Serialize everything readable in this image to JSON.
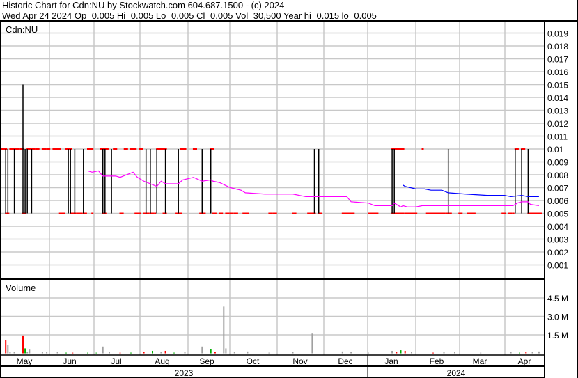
{
  "header": {
    "title": "Historic Chart for Cdn:NU by Stockwatch.com 604.687.1500 - (c) 2024",
    "summary": "Wed Apr 24 2024  Op=0.005  Hi=0.005  Lo=0.005  Cl=0.005  Vol=30,500  Year hi=0.015  lo=0.005"
  },
  "chart_data": [
    {
      "type": "line",
      "title": "Cdn:NU",
      "x_unit": "trading day index (0 = late Apr 2023)",
      "ylim": [
        0,
        0.02
      ],
      "y_ticks": [
        "0.001",
        "0.002",
        "0.003",
        "0.004",
        "0.005",
        "0.006",
        "0.007",
        "0.008",
        "0.009",
        "0.01",
        "0.011",
        "0.012",
        "0.013",
        "0.014",
        "0.015",
        "0.016",
        "0.017",
        "0.018",
        "0.019"
      ],
      "grid": true,
      "colors": {
        "close": "#ff0000",
        "range": "#000000",
        "ma_short": "#ff00ff",
        "ma_long": "#0000ff"
      },
      "close_segments_0_01": [
        [
          0,
          2
        ],
        [
          4,
          8
        ],
        [
          9,
          10
        ],
        [
          12,
          15
        ],
        [
          16,
          17
        ],
        [
          19,
          20
        ],
        [
          21,
          22
        ],
        [
          24,
          27
        ],
        [
          30,
          32
        ],
        [
          40,
          42
        ],
        [
          46,
          47
        ],
        [
          48,
          49
        ],
        [
          52,
          53
        ],
        [
          57,
          58
        ],
        [
          60,
          62
        ],
        [
          64,
          65
        ],
        [
          72,
          76
        ],
        [
          83,
          85
        ],
        [
          89,
          90
        ],
        [
          97,
          98
        ],
        [
          181,
          186
        ],
        [
          195,
          195
        ],
        [
          238,
          239
        ],
        [
          241,
          242
        ]
      ],
      "close_segments_0_005": [
        [
          2,
          3
        ],
        [
          10,
          11
        ],
        [
          27,
          29
        ],
        [
          32,
          34
        ],
        [
          35,
          37
        ],
        [
          38,
          39
        ],
        [
          42,
          42
        ],
        [
          47,
          48
        ],
        [
          55,
          56
        ],
        [
          62,
          64
        ],
        [
          66,
          68
        ],
        [
          69,
          70
        ],
        [
          71,
          71
        ],
        [
          75,
          76
        ],
        [
          81,
          83
        ],
        [
          92,
          94
        ],
        [
          98,
          99
        ],
        [
          101,
          102
        ],
        [
          104,
          105
        ],
        [
          106,
          107
        ],
        [
          108,
          109
        ],
        [
          112,
          114
        ],
        [
          124,
          125
        ],
        [
          126,
          127
        ],
        [
          135,
          136
        ],
        [
          142,
          144
        ],
        [
          144,
          145
        ],
        [
          147,
          148
        ],
        [
          158,
          163
        ],
        [
          170,
          174
        ],
        [
          181,
          182
        ],
        [
          183,
          184
        ],
        [
          185,
          186
        ],
        [
          187,
          192
        ],
        [
          197,
          198
        ],
        [
          199,
          201
        ],
        [
          202,
          204
        ],
        [
          204,
          205
        ],
        [
          206,
          208
        ],
        [
          212,
          213
        ],
        [
          216,
          217
        ],
        [
          218,
          219
        ],
        [
          232,
          233
        ],
        [
          235,
          236
        ],
        [
          237,
          237
        ],
        [
          244,
          250
        ]
      ],
      "range_bars": [
        [
          2,
          0.005,
          0.01
        ],
        [
          3,
          0.005,
          0.01
        ],
        [
          6,
          0.005,
          0.01
        ],
        [
          10,
          0.005,
          0.015
        ],
        [
          11,
          0.005,
          0.01
        ],
        [
          12,
          0.005,
          0.01
        ],
        [
          14,
          0.005,
          0.01
        ],
        [
          31,
          0.005,
          0.01
        ],
        [
          32,
          0.005,
          0.01
        ],
        [
          34,
          0.005,
          0.01
        ],
        [
          38,
          0.005,
          0.01
        ],
        [
          47,
          0.005,
          0.01
        ],
        [
          48,
          0.005,
          0.01
        ],
        [
          51,
          0.005,
          0.01
        ],
        [
          67,
          0.005,
          0.01
        ],
        [
          69,
          0.005,
          0.01
        ],
        [
          72,
          0.005,
          0.01
        ],
        [
          76,
          0.005,
          0.01
        ],
        [
          82,
          0.005,
          0.01
        ],
        [
          93,
          0.005,
          0.01
        ],
        [
          97,
          0.005,
          0.01
        ],
        [
          145,
          0.005,
          0.01
        ],
        [
          147,
          0.005,
          0.01
        ],
        [
          181,
          0.005,
          0.01
        ],
        [
          182,
          0.005,
          0.01
        ],
        [
          207,
          0.005,
          0.01
        ],
        [
          238,
          0.005,
          0.01
        ],
        [
          241,
          0.005,
          0.01
        ],
        [
          244,
          0.005,
          0.01
        ]
      ],
      "ma_short": [
        [
          40,
          0.0083
        ],
        [
          42,
          0.0082
        ],
        [
          45,
          0.0083
        ],
        [
          47,
          0.0079
        ],
        [
          53,
          0.0079
        ],
        [
          55,
          0.0078
        ],
        [
          61,
          0.0082
        ],
        [
          63,
          0.0078
        ],
        [
          66,
          0.0075
        ],
        [
          72,
          0.0071
        ],
        [
          74,
          0.0075
        ],
        [
          76,
          0.0073
        ],
        [
          82,
          0.0073
        ],
        [
          84,
          0.0076
        ],
        [
          89,
          0.0078
        ],
        [
          93,
          0.0075
        ],
        [
          97,
          0.0076
        ],
        [
          98,
          0.0075
        ],
        [
          101,
          0.0074
        ],
        [
          106,
          0.007
        ],
        [
          111,
          0.0068
        ],
        [
          113,
          0.0066
        ],
        [
          122,
          0.0065
        ],
        [
          135,
          0.0065
        ],
        [
          141,
          0.0063
        ],
        [
          160,
          0.0063
        ],
        [
          162,
          0.0059
        ],
        [
          170,
          0.0058
        ],
        [
          173,
          0.0056
        ],
        [
          181,
          0.0056
        ],
        [
          182,
          0.0058
        ],
        [
          185,
          0.0055
        ],
        [
          186,
          0.0056
        ],
        [
          188,
          0.0055
        ],
        [
          192,
          0.0055
        ],
        [
          195,
          0.0056
        ],
        [
          237,
          0.0056
        ],
        [
          239,
          0.0058
        ],
        [
          241,
          0.0059
        ],
        [
          244,
          0.0059
        ],
        [
          245,
          0.0057
        ],
        [
          249,
          0.0056
        ]
      ],
      "ma_long": [
        [
          186,
          0.0072
        ],
        [
          187,
          0.0071
        ],
        [
          192,
          0.0069
        ],
        [
          196,
          0.0069
        ],
        [
          199,
          0.0068
        ],
        [
          204,
          0.0068
        ],
        [
          207,
          0.0066
        ],
        [
          215,
          0.0065
        ],
        [
          225,
          0.0064
        ],
        [
          233,
          0.0064
        ],
        [
          236,
          0.0063
        ],
        [
          241,
          0.0064
        ],
        [
          244,
          0.0063
        ],
        [
          249,
          0.0063
        ]
      ]
    },
    {
      "type": "bar",
      "title": "Volume",
      "ylim": [
        0,
        6.0
      ],
      "y_unit": "M",
      "y_ticks": [
        "1.5 M",
        "3.0 M",
        "4.5 M"
      ],
      "colors": {
        "up": "#00b000",
        "down": "#ff0000",
        "flat": "#a0a0a0"
      },
      "bars": [
        [
          2,
          1.1,
          "down"
        ],
        [
          3,
          0.7,
          "flat"
        ],
        [
          4,
          0.1,
          "flat"
        ],
        [
          6,
          0.1,
          "flat"
        ],
        [
          10,
          1.45,
          "down"
        ],
        [
          11,
          0.4,
          "up"
        ],
        [
          12,
          0.1,
          "flat"
        ],
        [
          13,
          0.3,
          "flat"
        ],
        [
          19,
          0.1,
          "flat"
        ],
        [
          21,
          0.1,
          "flat"
        ],
        [
          26,
          0.1,
          "flat"
        ],
        [
          30,
          0.05,
          "up"
        ],
        [
          33,
          0.05,
          "down"
        ],
        [
          40,
          0.05,
          "up"
        ],
        [
          44,
          0.05,
          "up"
        ],
        [
          47,
          0.55,
          "flat"
        ],
        [
          50,
          0.1,
          "flat"
        ],
        [
          55,
          0.05,
          "down"
        ],
        [
          60,
          0.05,
          "up"
        ],
        [
          66,
          0.1,
          "down"
        ],
        [
          70,
          0.2,
          "up"
        ],
        [
          74,
          0.1,
          "flat"
        ],
        [
          76,
          0.2,
          "down"
        ],
        [
          80,
          0.05,
          "up"
        ],
        [
          85,
          0.1,
          "flat"
        ],
        [
          93,
          0.55,
          "flat"
        ],
        [
          97,
          0.35,
          "up"
        ],
        [
          99,
          0.1,
          "down"
        ],
        [
          103,
          3.8,
          "flat"
        ],
        [
          104,
          0.4,
          "flat"
        ],
        [
          108,
          0.1,
          "flat"
        ],
        [
          114,
          0.15,
          "flat"
        ],
        [
          124,
          0.05,
          "flat"
        ],
        [
          135,
          0.1,
          "flat"
        ],
        [
          144,
          1.6,
          "flat"
        ],
        [
          158,
          0.15,
          "flat"
        ],
        [
          162,
          0.1,
          "flat"
        ],
        [
          170,
          0.05,
          "flat"
        ],
        [
          181,
          0.2,
          "flat"
        ],
        [
          183,
          0.1,
          "down"
        ],
        [
          185,
          0.25,
          "up"
        ],
        [
          187,
          0.2,
          "down"
        ],
        [
          190,
          0.1,
          "flat"
        ],
        [
          200,
          0.05,
          "down"
        ],
        [
          205,
          0.1,
          "flat"
        ],
        [
          210,
          0.1,
          "flat"
        ],
        [
          222,
          0.05,
          "flat"
        ],
        [
          236,
          0.1,
          "flat"
        ],
        [
          240,
          0.05,
          "up"
        ],
        [
          243,
          0.1,
          "down"
        ],
        [
          246,
          0.1,
          "flat"
        ],
        [
          249,
          0.15,
          "flat"
        ]
      ]
    }
  ],
  "x_axis": {
    "months": [
      "May",
      "Jun",
      "Jul",
      "Aug",
      "Sep",
      "Oct",
      "Nov",
      "Dec",
      "Jan",
      "Feb",
      "Mar",
      "Apr"
    ],
    "years": [
      "2023",
      "2024"
    ]
  }
}
